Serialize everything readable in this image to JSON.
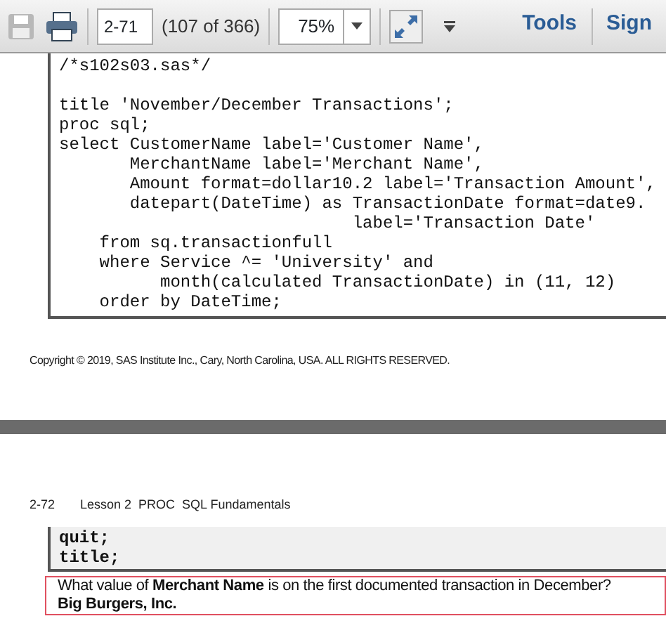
{
  "toolbar": {
    "save_disabled": true,
    "page_field": "2-71",
    "page_count": "(107 of 366)",
    "zoom_field": "75%",
    "links": [
      "Tools",
      "Sign"
    ]
  },
  "page_1": {
    "code_comment": "/*s102s03.sas*/",
    "code_lines": [
      "title 'November/December Transactions';",
      "proc sql;",
      "select CustomerName label='Customer Name',",
      "       MerchantName label='Merchant Name',",
      "       Amount format=dollar10.2 label='Transaction Amount',",
      "       datepart(DateTime) as TransactionDate format=date9.",
      "                             label='Transaction Date'",
      "    from sq.transactionfull",
      "    where Service ^= 'University' and",
      "          month(calculated TransactionDate) in (11, 12)",
      "    order by DateTime;"
    ],
    "copyright": "Copyright © 2019, SAS Institute Inc., Cary, North Carolina, USA. ALL RIGHTS RESERVED."
  },
  "page_2": {
    "page_number": "2-72",
    "header": "Lesson 2  PROC  SQL Fundamentals",
    "code_lines": [
      "quit;",
      "title;"
    ],
    "question": "What value of **Merchant Name** is on the first documented transaction in December?",
    "answer": "Big Burgers, Inc."
  }
}
